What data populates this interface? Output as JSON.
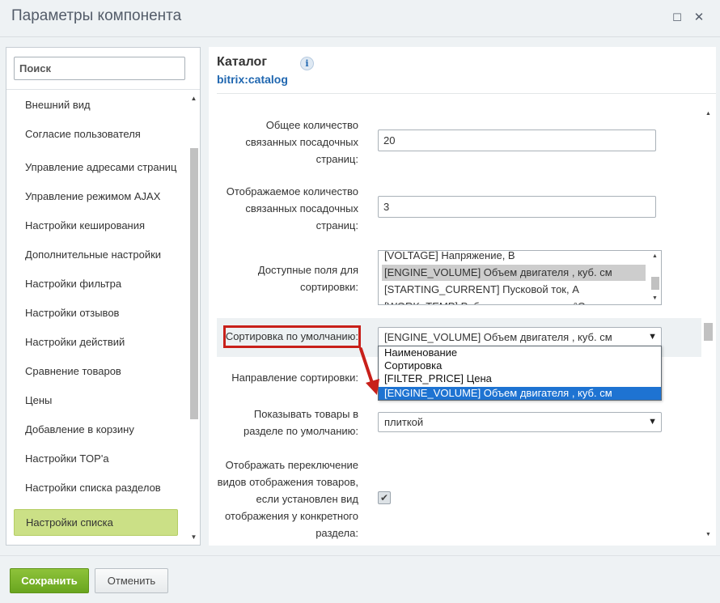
{
  "window": {
    "title": "Параметры компонента"
  },
  "sidebar": {
    "search_placeholder": "Поиск",
    "items": [
      {
        "label": "Внешний вид"
      },
      {
        "label": "Согласие пользователя"
      },
      {
        "label": "Управление адресами страниц"
      },
      {
        "label": "Управление режимом AJAX"
      },
      {
        "label": "Настройки кеширования"
      },
      {
        "label": "Дополнительные настройки"
      },
      {
        "label": "Настройки фильтра"
      },
      {
        "label": "Настройки отзывов"
      },
      {
        "label": "Настройки действий"
      },
      {
        "label": "Сравнение товаров"
      },
      {
        "label": "Цены"
      },
      {
        "label": "Добавление в корзину"
      },
      {
        "label": "Настройки TOP'a"
      },
      {
        "label": "Настройки списка разделов"
      },
      {
        "label": "Настройки списка"
      }
    ],
    "active_item": "Настройки списка"
  },
  "component": {
    "title": "Каталог",
    "id": "bitrix:catalog"
  },
  "fields": {
    "total_landing_label": "Общее количество связанных посадочных страниц:",
    "total_landing_value": "20",
    "shown_landing_label": "Отображаемое количество связанных посадочных страниц:",
    "shown_landing_value": "3",
    "sort_fields_label": "Доступные поля для сортировки:",
    "sort_fields_options": [
      {
        "label": "[VOLTAGE] Напряжение, В",
        "selected": false
      },
      {
        "label": "[ENGINE_VOLUME] Объем двигателя , куб. см",
        "selected": true
      },
      {
        "label": "[STARTING_CURRENT] Пусковой ток, А",
        "selected": false
      },
      {
        "label": "[WORK_TEMP] Рабочая температура, °С",
        "selected": false
      }
    ],
    "default_sort_label": "Сортировка по умолчанию:",
    "default_sort_value": "[ENGINE_VOLUME] Объем двигателя , куб. см",
    "default_sort_dropdown": [
      {
        "label": "Наименование",
        "selected": false
      },
      {
        "label": "Сортировка",
        "selected": false
      },
      {
        "label": "[FILTER_PRICE] Цена",
        "selected": false
      },
      {
        "label": "[ENGINE_VOLUME] Объем двигателя , куб. см",
        "selected": true
      }
    ],
    "sort_direction_label": "Направление сортировки:",
    "show_section_label": "Показывать товары в разделе по умолчанию:",
    "show_section_value": "плиткой",
    "view_switch_label": "Отображать переключение видов отображения товаров, если установлен вид отображения у конкретного раздела:",
    "view_switch_checked": true
  },
  "footer": {
    "save_label": "Сохранить",
    "cancel_label": "Отменить"
  },
  "colors": {
    "accent_green": "#7ab52b",
    "link_blue": "#2067b0",
    "highlight_red": "#c8201a",
    "dropdown_selected": "#1e73d2"
  }
}
